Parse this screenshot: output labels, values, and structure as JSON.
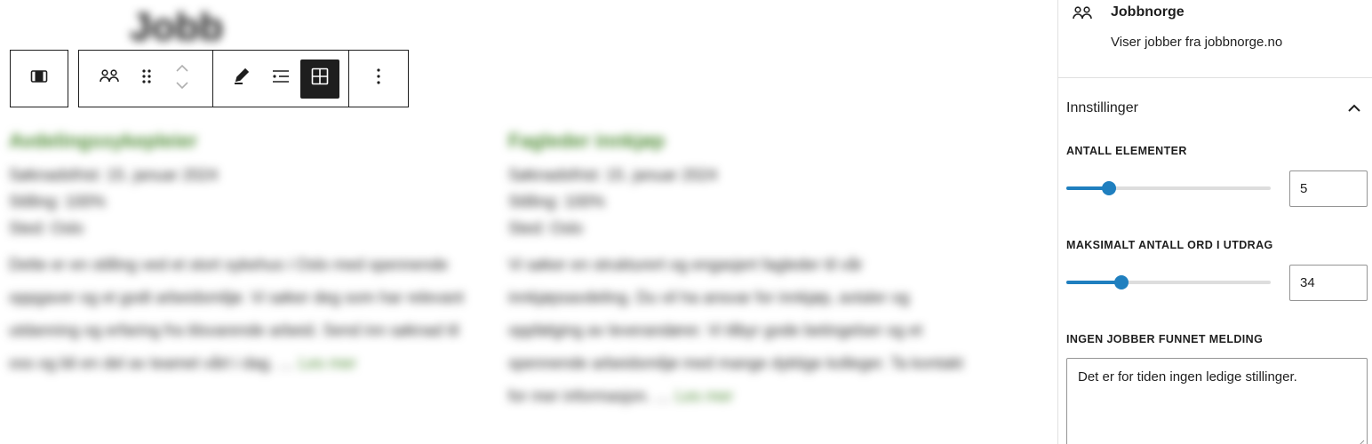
{
  "canvas": {
    "heading": "Jobb",
    "jobs": [
      {
        "title": "Avdelingssykepleier",
        "meta": [
          "Søknadsfrist: 15. januar 2024",
          "Stilling: 100%",
          "Sted: Oslo"
        ],
        "excerpt": "Dette er en stilling ved et stort sykehus i Oslo med spennende oppgaver og et godt arbeidsmiljø. Vi søker deg som har relevant utdanning og erfaring fra tilsvarende arbeid. Send inn søknad til oss og bli en del av teamet vårt i dag.",
        "read_more": "Les mer"
      },
      {
        "title": "Fagleder innkjøp",
        "meta": [
          "Søknadsfrist: 15. januar 2024",
          "Stilling: 100%",
          "Sted: Oslo"
        ],
        "excerpt": "Vi søker en strukturert og engasjert fagleder til vår innkjøpsavdeling. Du vil ha ansvar for innkjøp, avtaler og oppfølging av leverandører. Vi tilbyr gode betingelser og et spennende arbeidsmiljø med mange dyktige kolleger. Ta kontakt for mer informasjon.",
        "read_more": "Les mer"
      }
    ]
  },
  "toolbar": {
    "block_type_icon": "columns-icon",
    "block_icon": "people-icon",
    "drag_icon": "drag-handle-icon",
    "move_icon": "move-up-down-icon",
    "edit_icon": "pencil-icon",
    "list_view_icon": "list-view-icon",
    "grid_view_icon": "grid-view-icon",
    "options_icon": "more-vertical-icon"
  },
  "sidebar": {
    "block": {
      "icon": "people-icon",
      "title": "Jobbnorge",
      "description": "Viser jobber fra jobbnorge.no"
    },
    "panel": {
      "title": "Innstillinger",
      "toggle_icon": "chevron-up-icon"
    },
    "controls": {
      "items_count": {
        "label": "ANTALL ELEMENTER",
        "value": "5",
        "slider_fraction": 0.21
      },
      "max_words": {
        "label": "MAKSIMALT ANTALL ORD I UTDRAG",
        "value": "34",
        "slider_fraction": 0.27
      },
      "no_jobs_message": {
        "label": "INGEN JOBBER FUNNET MELDING",
        "value": "Det er for tiden ingen ledige stillinger."
      }
    }
  },
  "colors": {
    "accent": "#1f7fbf",
    "link_green": "#4c8a32",
    "text": "#1e1e1e"
  }
}
